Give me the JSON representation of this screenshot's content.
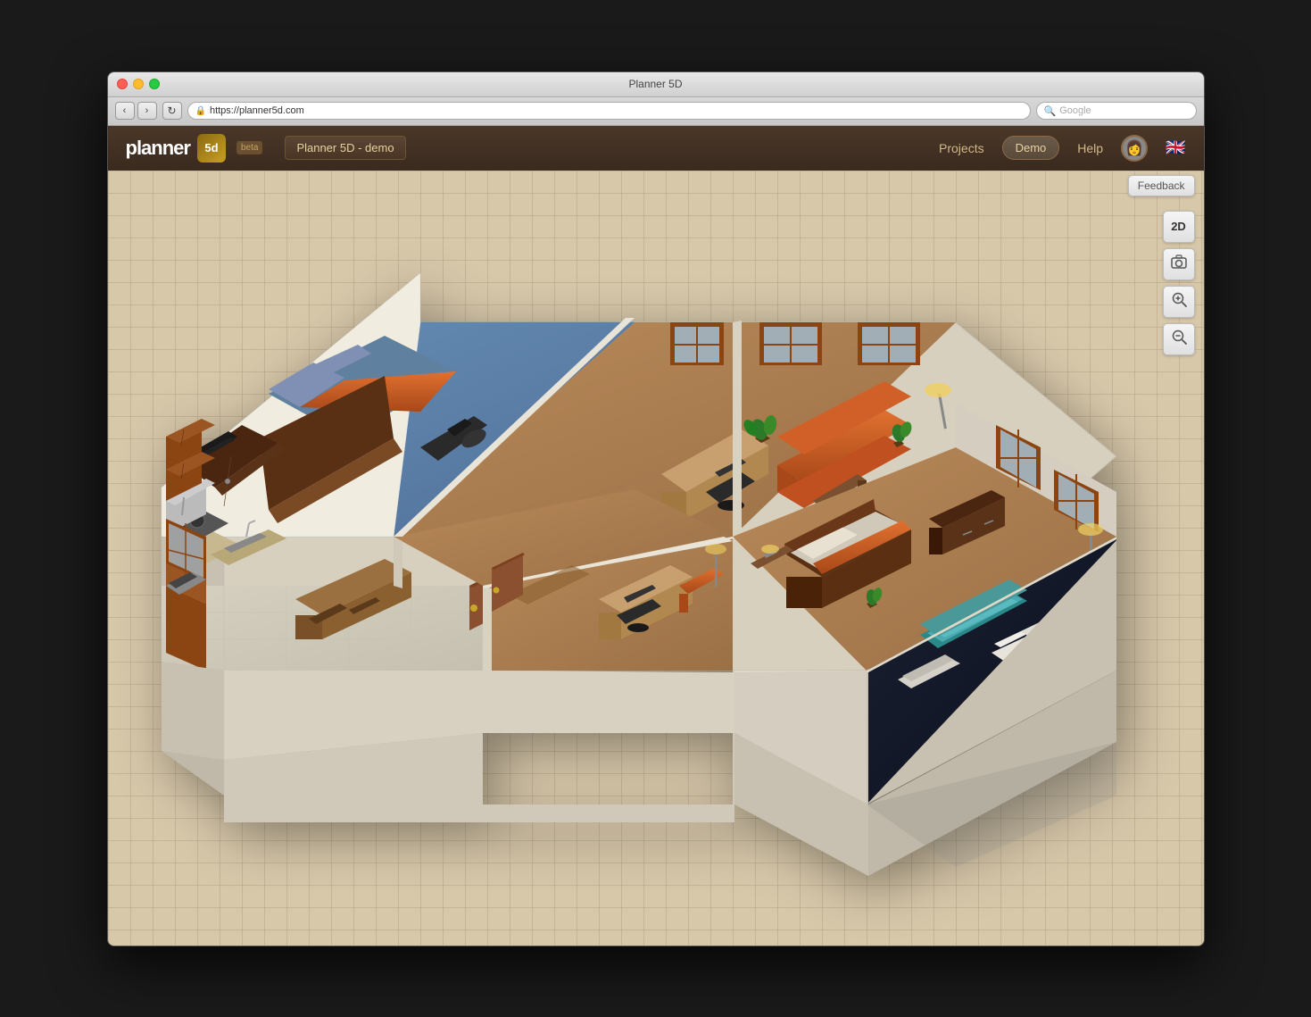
{
  "window": {
    "title": "Planner 5D",
    "traffic_lights": [
      "close",
      "minimize",
      "maximize"
    ]
  },
  "browser": {
    "back_label": "‹",
    "forward_label": "›",
    "reload_label": "↻",
    "url": "https://planner5d.com",
    "search_placeholder": "Google"
  },
  "header": {
    "logo_text": "planner",
    "logo_suffix": "5d",
    "beta_label": "beta",
    "project_name": "Planner 5D - demo",
    "nav_projects": "Projects",
    "nav_demo": "Demo",
    "nav_help": "Help",
    "flag": "🇬🇧"
  },
  "toolbar": {
    "feedback_label": "Feedback",
    "btn_2d": "2D",
    "btn_camera": "📷",
    "btn_zoom_in": "🔍+",
    "btn_zoom_out": "🔍-"
  },
  "canvas": {
    "view_mode": "3D",
    "grid_visible": true
  }
}
